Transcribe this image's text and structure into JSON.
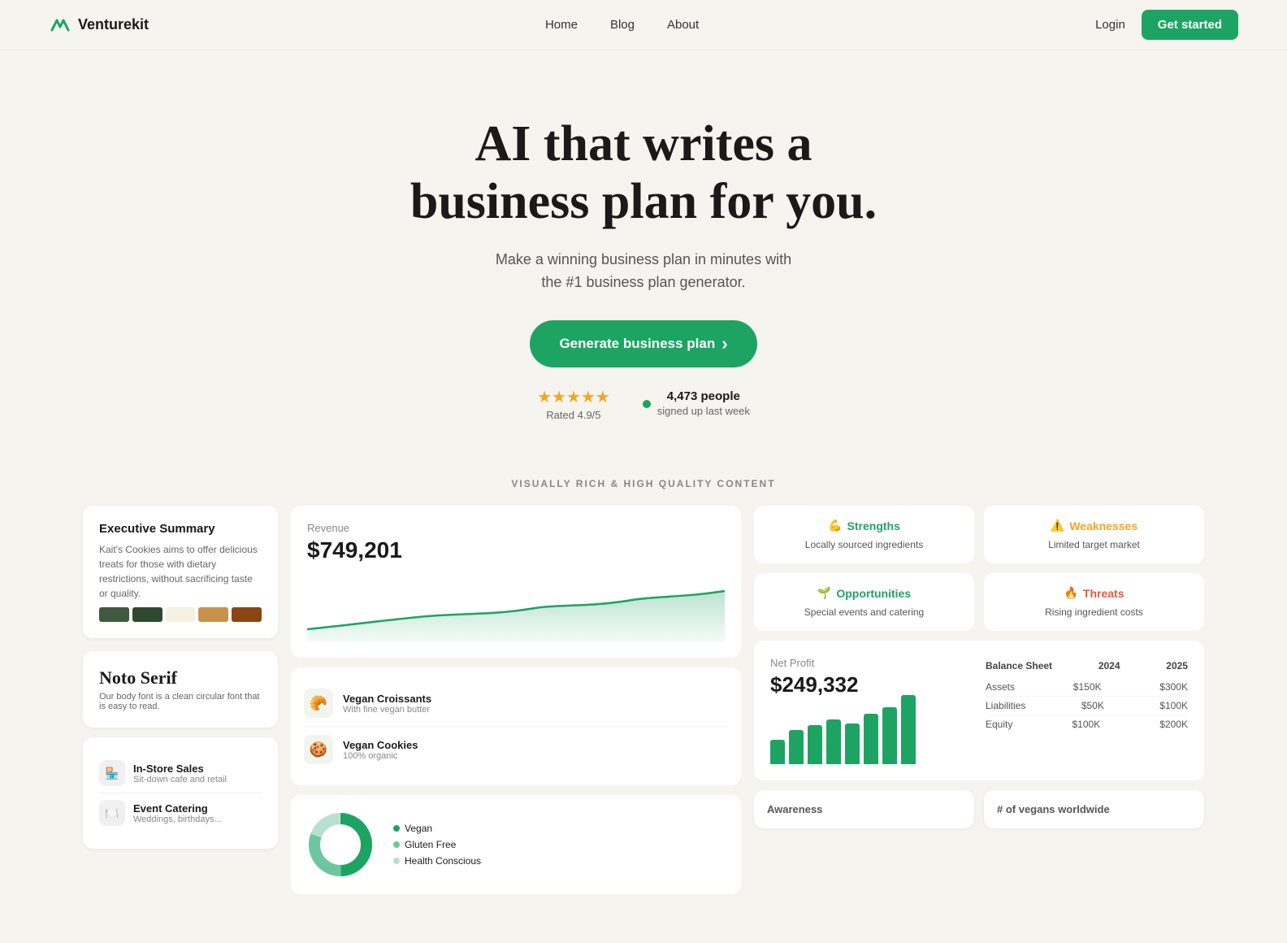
{
  "nav": {
    "logo_text": "Venturekit",
    "links": [
      "Home",
      "Blog",
      "About"
    ],
    "login_label": "Login",
    "cta_label": "Get started"
  },
  "hero": {
    "headline_line1": "AI that writes a",
    "headline_line2": "business plan for you.",
    "subtitle": "Make a winning business plan in minutes with\nthe #1 business plan generator.",
    "cta_label": "Generate business plan",
    "stars": "★★★★★",
    "rated": "Rated 4.9/5",
    "signups_count": "4,473 people",
    "signups_sub": "signed up last week"
  },
  "section_label": "VISUALLY RICH & HIGH QUALITY CONTENT",
  "left": {
    "exec_title": "Executive Summary",
    "exec_text": "Kait's Cookies aims to offer delicious treats for those with dietary restrictions, without sacrificing taste or quality.",
    "swatches": [
      "#3d5a3e",
      "#2d4a2e",
      "#f5f0e0",
      "#c8924a",
      "#8b4513"
    ],
    "font_name": "Noto Serif",
    "font_desc": "Our body font is a clean circular font that is easy to read.",
    "channels": [
      {
        "icon": "🏪",
        "name": "In-Store Sales",
        "sub": "Sit-down cafe and retail"
      },
      {
        "icon": "🍽️",
        "name": "Event Catering",
        "sub": "Weddings, birthdays..."
      }
    ]
  },
  "middle": {
    "revenue_label": "Revenue",
    "revenue_value": "$749,201",
    "products": [
      {
        "icon": "🥐",
        "name": "Vegan Croissants",
        "sub": "With fine vegan butter"
      },
      {
        "icon": "🍪",
        "name": "Vegan Cookies",
        "sub": "100% organic"
      }
    ],
    "donut_legend": [
      {
        "color": "#1da462",
        "label": "Vegan"
      },
      {
        "color": "#6ec6a0",
        "label": "Gluten Free"
      },
      {
        "color": "#b8e0cf",
        "label": "Health Conscious"
      }
    ]
  },
  "right": {
    "swot": [
      {
        "icon": "💪",
        "title": "Strengths",
        "color": "#1da462",
        "desc": "Locally sourced ingredients"
      },
      {
        "icon": "⚠️",
        "title": "Weaknesses",
        "color": "#f5a623",
        "desc": "Limited target market"
      },
      {
        "icon": "🌱",
        "title": "Opportunities",
        "color": "#1da462",
        "desc": "Special events and catering"
      },
      {
        "icon": "🔥",
        "title": "Threats",
        "color": "#e05a3a",
        "desc": "Rising ingredient costs"
      }
    ],
    "net_label": "Net Profit",
    "net_value": "$249,332",
    "bars": [
      30,
      42,
      48,
      55,
      50,
      62,
      70,
      85
    ],
    "balance_sheet": {
      "title": "Balance Sheet",
      "year1": "2024",
      "year2": "2025",
      "rows": [
        {
          "label": "Assets",
          "val1": "$150K",
          "val2": "$300K"
        },
        {
          "label": "Liabilities",
          "val1": "$50K",
          "val2": "$100K"
        },
        {
          "label": "Equity",
          "val1": "$100K",
          "val2": "$200K"
        }
      ]
    },
    "awareness_title": "Awareness",
    "vegans_title": "# of vegans worldwide"
  }
}
